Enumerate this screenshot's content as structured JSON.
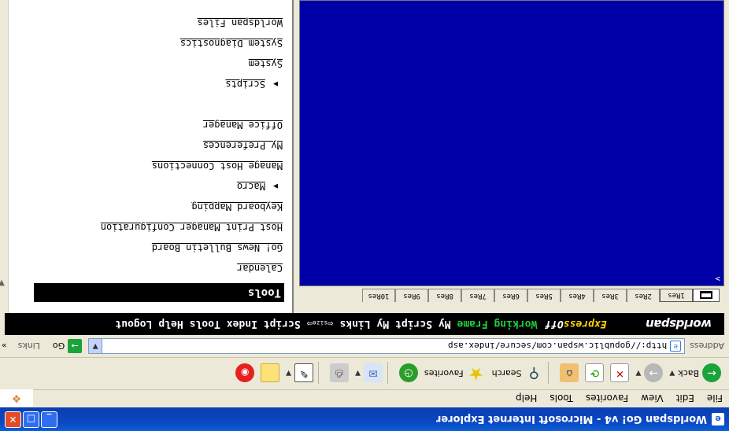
{
  "window": {
    "title": "Worldspan Go! v4 - Microsoft Internet Explorer",
    "minimize": "_",
    "maximize": "□",
    "close": "✕"
  },
  "menubar": {
    "items": [
      "File",
      "Edit",
      "View",
      "Favorites",
      "Tools",
      "Help"
    ]
  },
  "toolbar": {
    "back_label": "Back",
    "search_label": "Search",
    "favorites_label": "Favorites"
  },
  "address": {
    "label": "Address",
    "url": "http://gopublic.wspan.com/secure/index.asp",
    "go_label": "Go",
    "links_label": "Links",
    "more": "»"
  },
  "wsnav": {
    "logo": "worldspan",
    "express": "Express",
    "off": "Off",
    "working_frame": "Working Frame",
    "my_script": "My Script",
    "my_links": "My Links",
    "arrows_small": "size",
    "script_index": "Script Index",
    "tools": "Tools",
    "help": "Help",
    "logout": "Logout"
  },
  "terminal": {
    "tabs": [
      "1Res",
      "2Res",
      "3Res",
      "4Res",
      "5Res",
      "6Res",
      "7Res",
      "8Res",
      "9Res",
      "10Res"
    ],
    "prompt": ">"
  },
  "tools_panel": {
    "title": "Tools",
    "items": [
      {
        "label": "Calendar",
        "type": "item"
      },
      {
        "label": "Go! News Bulletin Board",
        "type": "item"
      },
      {
        "label": "Host Print Manager Configuration",
        "type": "item"
      },
      {
        "label": "Keyboard Mapping",
        "type": "item"
      },
      {
        "label": "Macro",
        "type": "submenu"
      },
      {
        "label": "Manage Host Connections",
        "type": "item"
      },
      {
        "label": "My Preferences",
        "type": "item"
      },
      {
        "label": "Office Manager",
        "type": "item"
      },
      {
        "label": "",
        "type": "gap"
      },
      {
        "label": "Scripts",
        "type": "submenu"
      },
      {
        "label": "System",
        "type": "item"
      },
      {
        "label": "System Diagnostics",
        "type": "item"
      },
      {
        "label": "Worldspan Files",
        "type": "item"
      }
    ]
  }
}
